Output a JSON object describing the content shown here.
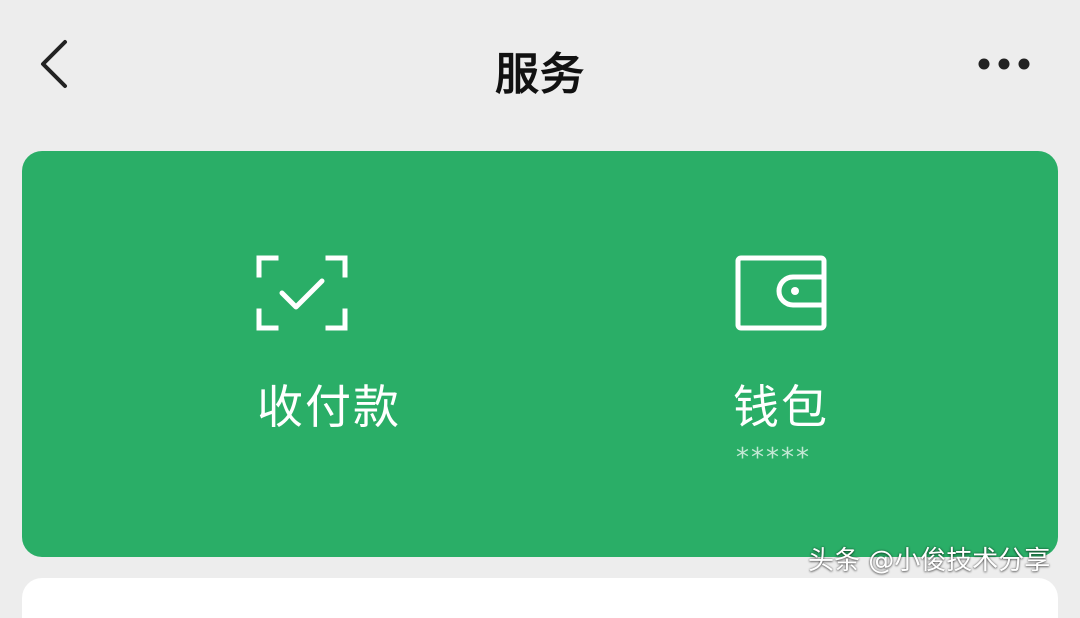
{
  "header": {
    "title": "服务",
    "back_icon": "chevron-left-icon",
    "more_icon": "more-dots-icon"
  },
  "service_card": {
    "background_color": "#2aae67",
    "items": [
      {
        "label": "收付款",
        "icon": "scan-check-icon"
      },
      {
        "label": "钱包",
        "sub": "*****",
        "icon": "wallet-icon"
      }
    ]
  },
  "watermark": "头条 @小俊技术分享"
}
